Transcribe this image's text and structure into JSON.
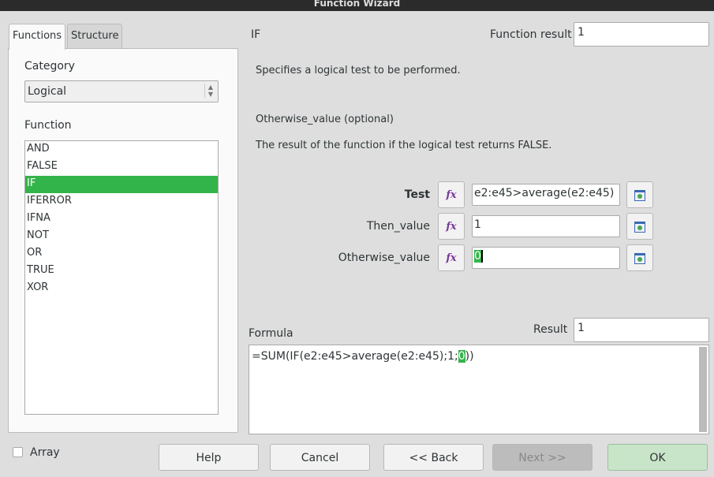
{
  "window": {
    "title": "Function Wizard"
  },
  "tabs": [
    {
      "label": "Functions"
    },
    {
      "label": "Structure"
    }
  ],
  "category": {
    "label": "Category",
    "value": "Logical"
  },
  "function": {
    "label": "Function",
    "items": [
      "AND",
      "FALSE",
      "IF",
      "IFERROR",
      "IFNA",
      "NOT",
      "OR",
      "TRUE",
      "XOR"
    ],
    "selected": "IF"
  },
  "details": {
    "name": "IF",
    "result_label": "Function result",
    "result_value": "1",
    "description": "Specifies a logical test to be performed.",
    "param_name": "Otherwise_value (optional)",
    "param_description": "The result of the function if the logical test returns FALSE."
  },
  "args": [
    {
      "label": "Test",
      "value": "e2:e45>average(e2:e45)"
    },
    {
      "label": "Then_value",
      "value": "1"
    },
    {
      "label": "Otherwise_value",
      "value": "0"
    }
  ],
  "formula": {
    "label": "Formula",
    "result_label": "Result",
    "result_value": "1",
    "prefix": "=SUM(IF(e2:e45>average(e2:e45);1;",
    "highlight": "0",
    "suffix": "))"
  },
  "array": {
    "label": "Array",
    "checked": false
  },
  "buttons": {
    "help": "Help",
    "cancel": "Cancel",
    "back": "<< Back",
    "next": "Next >>",
    "ok": "OK"
  },
  "colors": {
    "accent": "#33b44a",
    "ok_bg": "#c9e5c9"
  }
}
